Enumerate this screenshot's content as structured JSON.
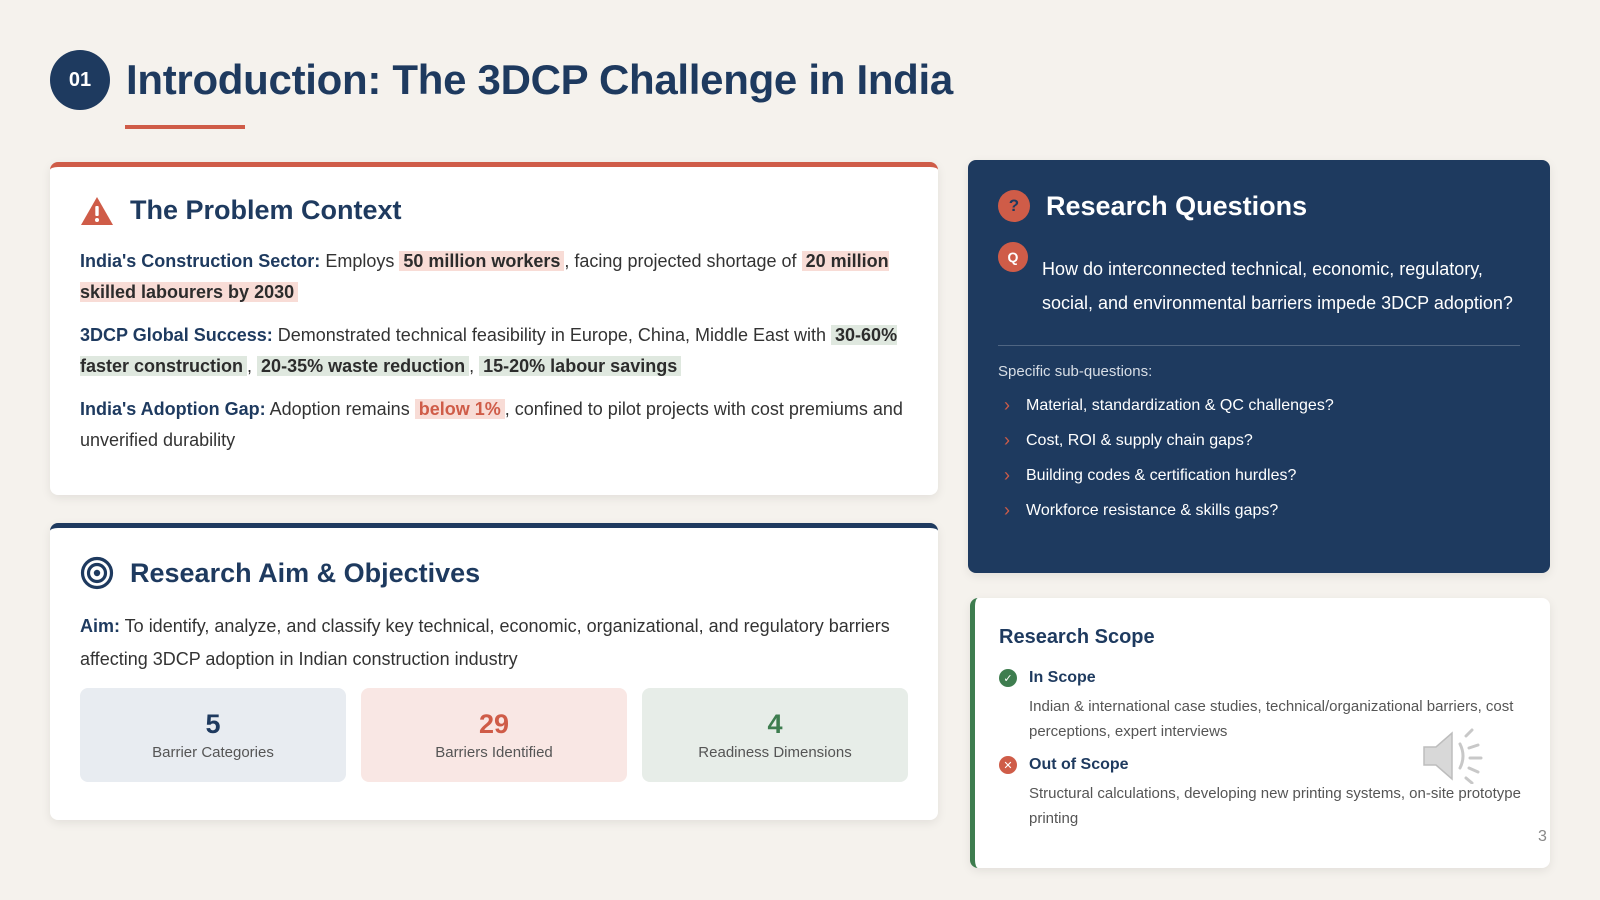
{
  "header": {
    "number": "01",
    "title": "Introduction: The 3DCP Challenge in India"
  },
  "problem": {
    "heading": "The Problem Context",
    "icon": "warning-triangle-icon",
    "sector": {
      "label": "India's Construction Sector:",
      "t1": " Employs ",
      "h1": "50 million workers",
      "t2": ", facing projected shortage of ",
      "h2": "20 million skilled labourers by 2030"
    },
    "global": {
      "label": "3DCP Global Success:",
      "t1": " Demonstrated technical feasibility in Europe, China, Middle East with ",
      "h1": "30-60% faster construction",
      "sep1": ", ",
      "h2": "20-35% waste reduction",
      "sep2": ", ",
      "h3": "15-20% labour savings"
    },
    "gap": {
      "label": "India's Adoption Gap:",
      "t1": " Adoption remains ",
      "h1": "below 1%",
      "t2": ", confined to pilot projects with cost premiums and unverified durability"
    }
  },
  "aim": {
    "heading": "Research Aim & Objectives",
    "icon": "target-icon",
    "label": "Aim:",
    "text": " To identify, analyze, and classify key technical, economic, organizational, and regulatory barriers affecting 3DCP adoption in Indian construction industry",
    "stats": [
      {
        "value": "5",
        "label": "Barrier Categories"
      },
      {
        "value": "29",
        "label": "Barriers Identified"
      },
      {
        "value": "4",
        "label": "Readiness Dimensions"
      }
    ]
  },
  "questions": {
    "heading": "Research Questions",
    "icon_glyph": "?",
    "q_badge": "Q",
    "main_question": "How do interconnected technical, economic, regulatory, social, and environmental barriers impede 3DCP adoption?",
    "sub_label": "Specific sub-questions:",
    "sub_items": [
      "Material, standardization & QC challenges?",
      "Cost, ROI & supply chain gaps?",
      "Building codes & certification hurdles?",
      "Workforce resistance & skills gaps?"
    ]
  },
  "scope": {
    "heading": "Research Scope",
    "in_title": "In Scope",
    "in_desc": "Indian & international case studies, technical/organizational barriers, cost perceptions, expert interviews",
    "out_title": "Out of Scope",
    "out_desc": "Structural calculations, developing new printing systems, on-site prototype printing"
  },
  "page_number": "3",
  "colors": {
    "navy": "#1e3a5f",
    "accent_red": "#cf5c48",
    "accent_green": "#3e7d4f",
    "background": "#f5f2ed"
  }
}
